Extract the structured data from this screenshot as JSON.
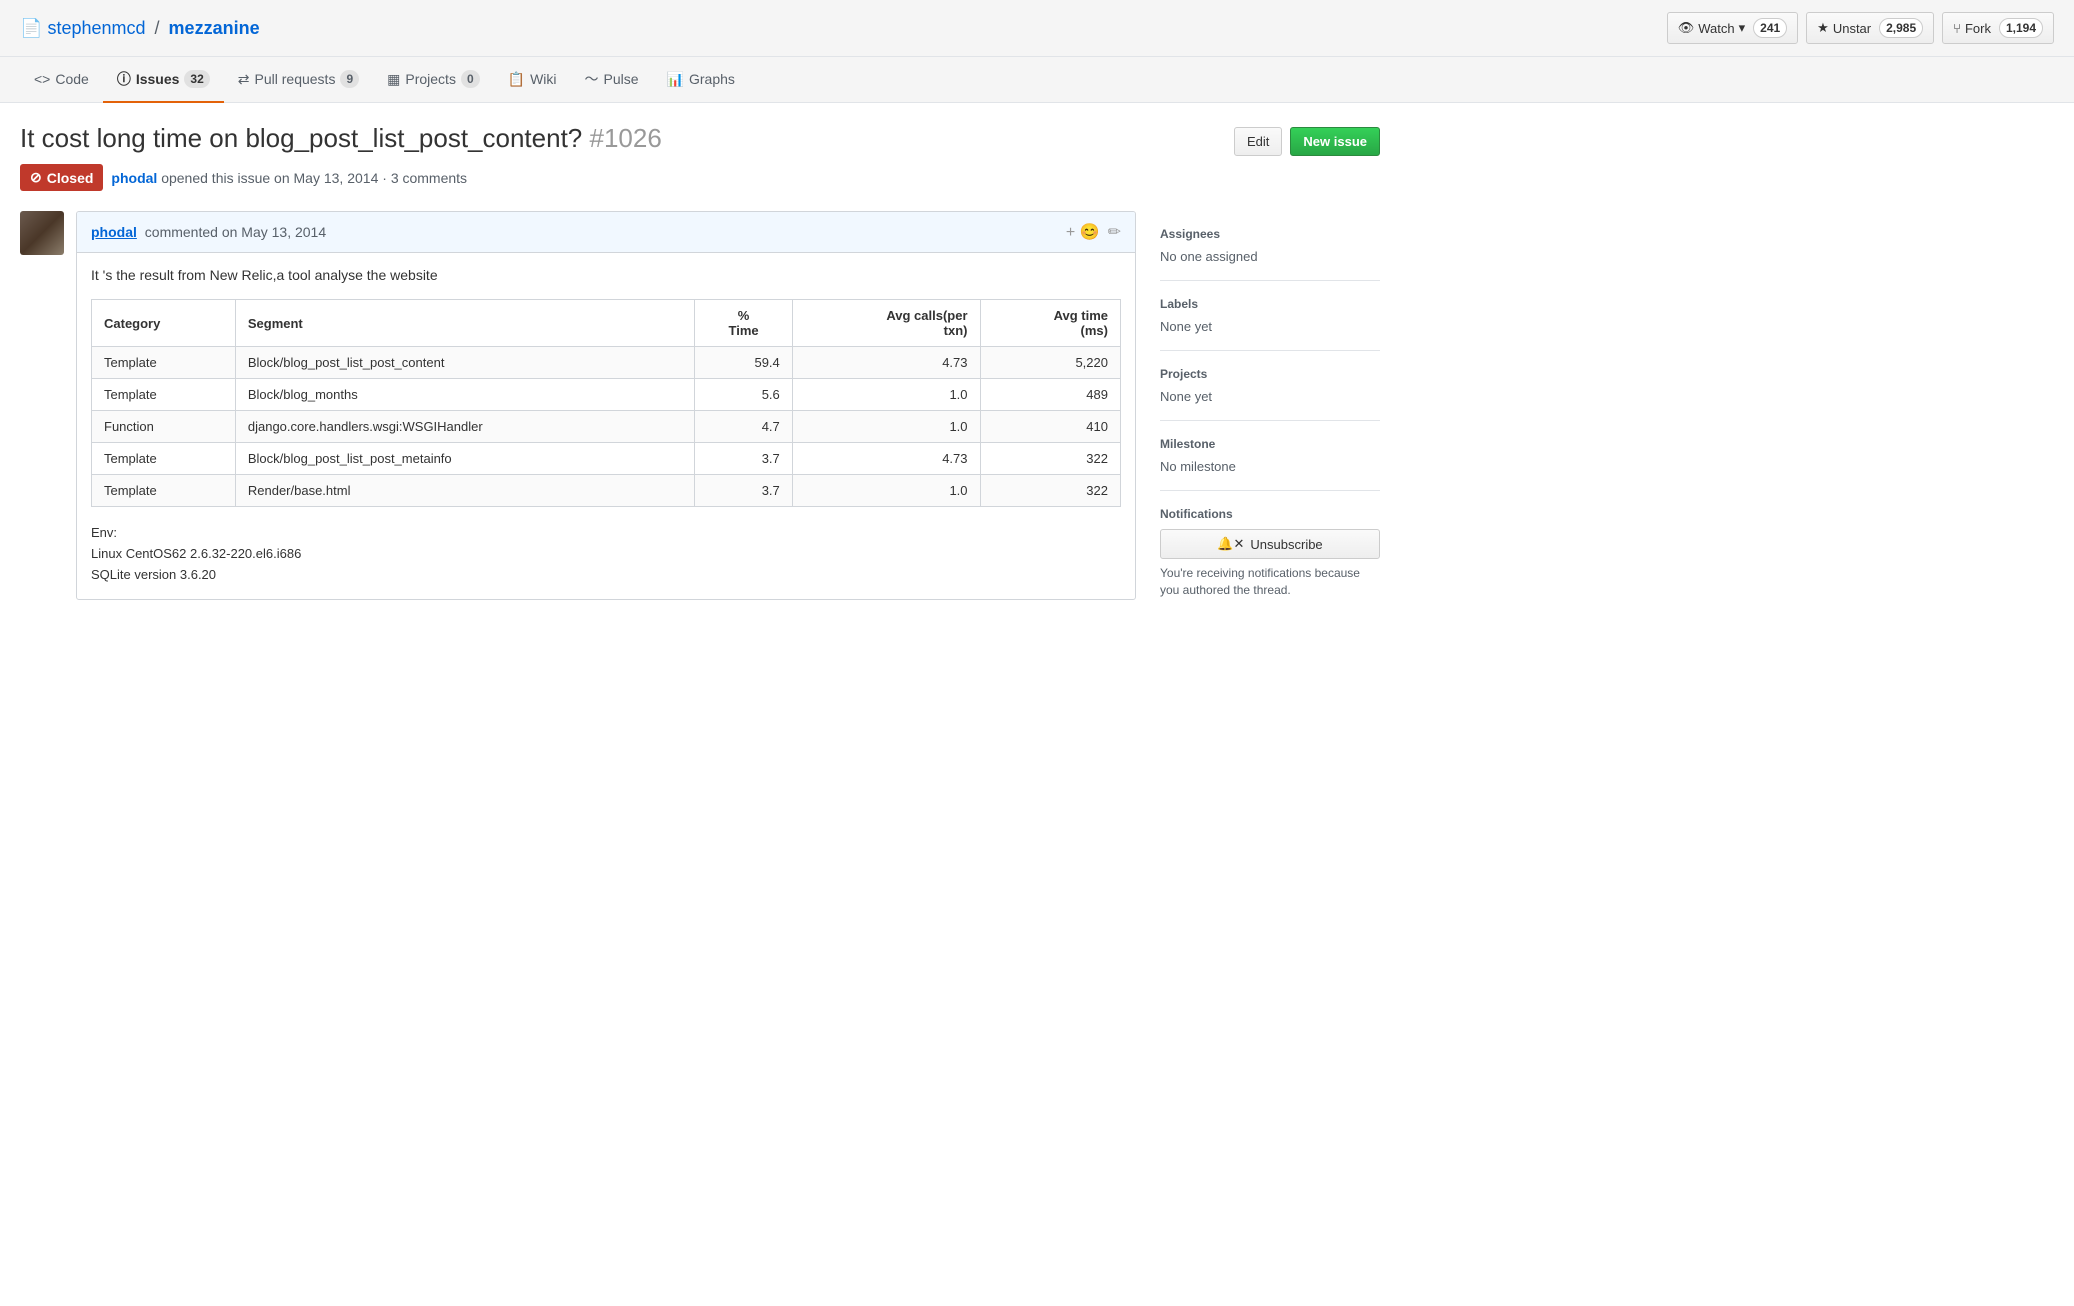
{
  "repo": {
    "owner": "stephenmcd",
    "name": "mezzanine",
    "owner_link": "#",
    "name_link": "#"
  },
  "actions": {
    "watch_label": "Watch",
    "watch_count": "241",
    "unstar_label": "Unstar",
    "unstar_count": "2,985",
    "fork_label": "Fork",
    "fork_count": "1,194"
  },
  "nav": {
    "tabs": [
      {
        "id": "code",
        "icon": "<>",
        "label": "Code",
        "badge": null
      },
      {
        "id": "issues",
        "icon": "ⓘ",
        "label": "Issues",
        "badge": "32",
        "active": true
      },
      {
        "id": "pull-requests",
        "icon": "⇄",
        "label": "Pull requests",
        "badge": "9"
      },
      {
        "id": "projects",
        "icon": "▦",
        "label": "Projects",
        "badge": "0"
      },
      {
        "id": "wiki",
        "icon": "📋",
        "label": "Wiki",
        "badge": null
      },
      {
        "id": "pulse",
        "icon": "〜",
        "label": "Pulse",
        "badge": null
      },
      {
        "id": "graphs",
        "icon": "📊",
        "label": "Graphs",
        "badge": null
      }
    ]
  },
  "issue": {
    "title": "It cost long time on blog_post_list_post_content?",
    "number": "#1026",
    "status": "Closed",
    "author": "phodal",
    "date": "opened this issue on May 13, 2014",
    "comments_count": "3 comments",
    "edit_label": "Edit",
    "new_issue_label": "New issue"
  },
  "comment": {
    "author": "phodal",
    "date": "commented on May 13, 2014",
    "intro": "It 's the result from New Relic,a tool analyse the website",
    "table": {
      "headers": [
        "Category",
        "Segment",
        "% Time",
        "Avg calls(per txn)",
        "Avg time (ms)"
      ],
      "rows": [
        [
          "Template",
          "Block/blog_post_list_post_content",
          "59.4",
          "4.73",
          "5,220"
        ],
        [
          "Template",
          "Block/blog_months",
          "5.6",
          "1.0",
          "489"
        ],
        [
          "Function",
          "django.core.handlers.wsgi:WSGIHandler",
          "4.7",
          "1.0",
          "410"
        ],
        [
          "Template",
          "Block/blog_post_list_post_metainfo",
          "3.7",
          "4.73",
          "322"
        ],
        [
          "Template",
          "Render/base.html",
          "3.7",
          "1.0",
          "322"
        ]
      ]
    },
    "env_label": "Env:",
    "env_lines": [
      "Linux CentOS62 2.6.32-220.el6.i686",
      "SQLite version 3.6.20"
    ]
  },
  "sidebar": {
    "assignees_title": "Assignees",
    "assignees_value": "No one assigned",
    "labels_title": "Labels",
    "labels_value": "None yet",
    "projects_title": "Projects",
    "projects_value": "None yet",
    "milestone_title": "Milestone",
    "milestone_value": "No milestone",
    "notifications_title": "Notifications",
    "unsubscribe_label": "Unsubscribe",
    "notifications_text": "You're receiving notifications because you authored the thread."
  }
}
